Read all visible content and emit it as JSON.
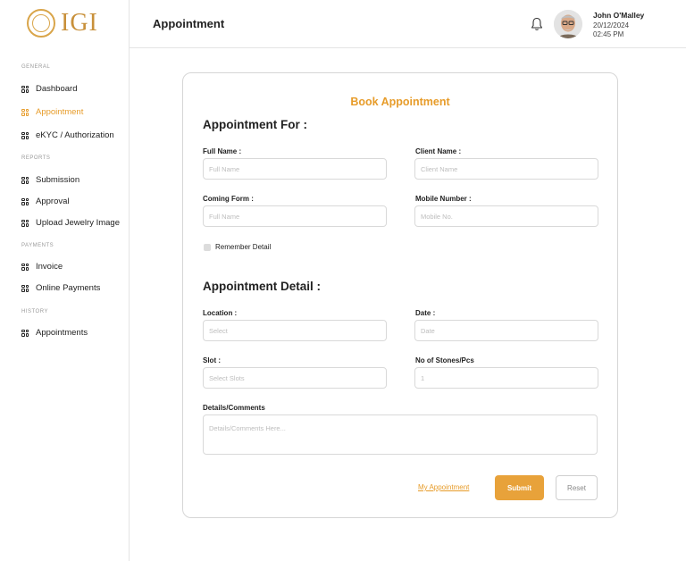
{
  "brand": {
    "name": "IGI",
    "accent_color": "#e79c2a",
    "logo_icon": "igi-seal-icon"
  },
  "sidebar": {
    "sections": [
      {
        "label": "GENERAL",
        "items": [
          {
            "label": "Dashboard",
            "icon": "grid-icon",
            "active": false
          },
          {
            "label": "Appointment",
            "icon": "grid-icon",
            "active": true
          },
          {
            "label": "eKYC / Authorization",
            "icon": "grid-icon",
            "active": false
          }
        ]
      },
      {
        "label": "REPORTS",
        "items": [
          {
            "label": "Submission",
            "icon": "grid-icon",
            "active": false
          },
          {
            "label": "Approval",
            "icon": "grid-icon",
            "active": false
          },
          {
            "label": "Upload Jewelry Image",
            "icon": "grid-icon",
            "active": false
          }
        ]
      },
      {
        "label": "PAYMENTS",
        "items": [
          {
            "label": "Invoice",
            "icon": "grid-icon",
            "active": false
          },
          {
            "label": "Online Payments",
            "icon": "grid-icon",
            "active": false
          }
        ]
      },
      {
        "label": "HISTORY",
        "items": [
          {
            "label": "Appointments",
            "icon": "grid-icon",
            "active": false
          }
        ]
      }
    ]
  },
  "header": {
    "title": "Appointment",
    "notification_icon": "bell-icon",
    "user": {
      "name": "John O'Malley",
      "date": "20/12/2024",
      "time": "02:45 PM"
    }
  },
  "form": {
    "title": "Book Appointment",
    "appointment_for": {
      "heading": "Appointment For :",
      "full_name": {
        "label": "Full Name :",
        "placeholder": "Full Name"
      },
      "client_name": {
        "label": "Client Name :",
        "placeholder": "Client Name"
      },
      "coming_from": {
        "label": "Coming Form :",
        "placeholder": "Full Name"
      },
      "mobile_number": {
        "label": "Mobile Number :",
        "placeholder": "Mobile No."
      },
      "remember": {
        "label": "Remember Detail",
        "checked": false
      }
    },
    "appointment_detail": {
      "heading": "Appointment Detail :",
      "location": {
        "label": "Location :",
        "placeholder": "Select"
      },
      "date": {
        "label": "Date :",
        "placeholder": "Date"
      },
      "slot": {
        "label": "Slot :",
        "placeholder": "Select Slots"
      },
      "stones": {
        "label": "No of Stones/Pcs",
        "value": "1"
      },
      "comments": {
        "label": "Details/Comments",
        "placeholder": "Details/Comments Here..."
      }
    },
    "actions": {
      "my_appointment": "My Appointment",
      "submit": "Submit",
      "reset": "Reset"
    }
  }
}
